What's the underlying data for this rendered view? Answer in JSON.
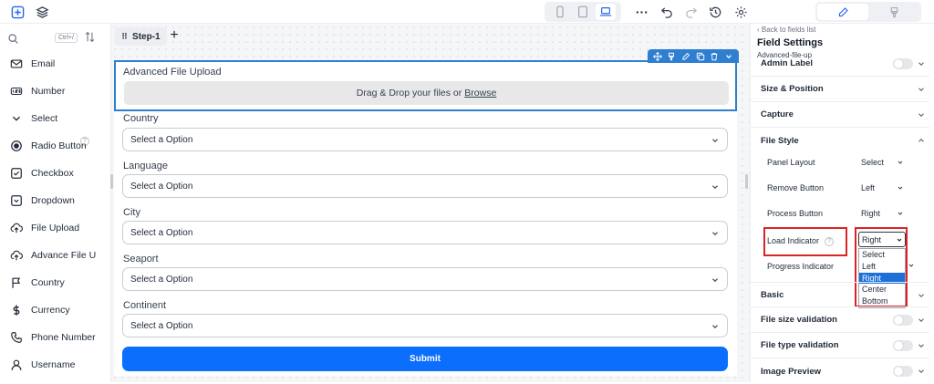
{
  "topbar": {
    "devices": [
      "mobile-icon",
      "tablet-icon",
      "laptop-icon"
    ],
    "active_device": 2,
    "actions": [
      "more-icon",
      "undo-icon",
      "redo-icon",
      "history-icon",
      "settings-icon"
    ],
    "right_tabs": [
      "edit-icon",
      "brush-icon"
    ]
  },
  "sidebar": {
    "search": {
      "placeholder": "",
      "shortcut": "Ctrl+/"
    },
    "items": [
      {
        "label": "Email",
        "icon": "envelope-icon"
      },
      {
        "label": "Number",
        "icon": "number-icon"
      },
      {
        "label": "Select",
        "icon": "chevron-down-icon"
      },
      {
        "label": "Radio Button",
        "icon": "radio-icon"
      },
      {
        "label": "Checkbox",
        "icon": "checkbox-icon"
      },
      {
        "label": "Dropdown",
        "icon": "dropdown-icon"
      },
      {
        "label": "File Upload",
        "icon": "upload-cloud-icon"
      },
      {
        "label": "Advance File U",
        "icon": "upload-cloud-icon"
      },
      {
        "label": "Country",
        "icon": "flag-icon"
      },
      {
        "label": "Currency",
        "icon": "dollar-icon"
      },
      {
        "label": "Phone Number",
        "icon": "phone-icon"
      },
      {
        "label": "Username",
        "icon": "user-icon"
      }
    ]
  },
  "canvas": {
    "step_tab": "Step-1",
    "add_step": "+",
    "upload": {
      "label": "Advanced File Upload",
      "drop_text": "Drag & Drop your files or",
      "browse_text": "Browse"
    },
    "fields": [
      {
        "label": "Country",
        "placeholder": "Select a Option"
      },
      {
        "label": "Language",
        "placeholder": "Select a Option"
      },
      {
        "label": "City",
        "placeholder": "Select a Option"
      },
      {
        "label": "Seaport",
        "placeholder": "Select a Option"
      },
      {
        "label": "Continent",
        "placeholder": "Select a Option"
      }
    ],
    "submit": "Submit"
  },
  "right_panel": {
    "back_link": "Back to fields list",
    "title": "Field Settings",
    "subtitle": "Advanced-file-up",
    "sections_top": [
      {
        "label": "Admin Label",
        "toggle": false
      },
      {
        "label": "Size & Position"
      },
      {
        "label": "Capture"
      },
      {
        "label": "File Style",
        "expanded": true
      }
    ],
    "file_style": {
      "panel_layout": {
        "label": "Panel Layout",
        "value": "Select"
      },
      "remove_button": {
        "label": "Remove Button",
        "value": "Left"
      },
      "process_button": {
        "label": "Process Button",
        "value": "Right"
      },
      "load_indicator": {
        "label": "Load Indicator",
        "value": "Right",
        "options": [
          "Select",
          "Left",
          "Right",
          "Center",
          "Bottom"
        ],
        "selected_index": 2
      },
      "progress_indicator": {
        "label": "Progress Indicator"
      }
    },
    "sections_bottom": [
      {
        "label": "Basic"
      },
      {
        "label": "File size validation",
        "toggle": false
      },
      {
        "label": "File type validation",
        "toggle": false
      },
      {
        "label": "Image Preview",
        "toggle": false
      }
    ],
    "highlight_color": "#d92525",
    "accent": "#2f7fd1"
  }
}
